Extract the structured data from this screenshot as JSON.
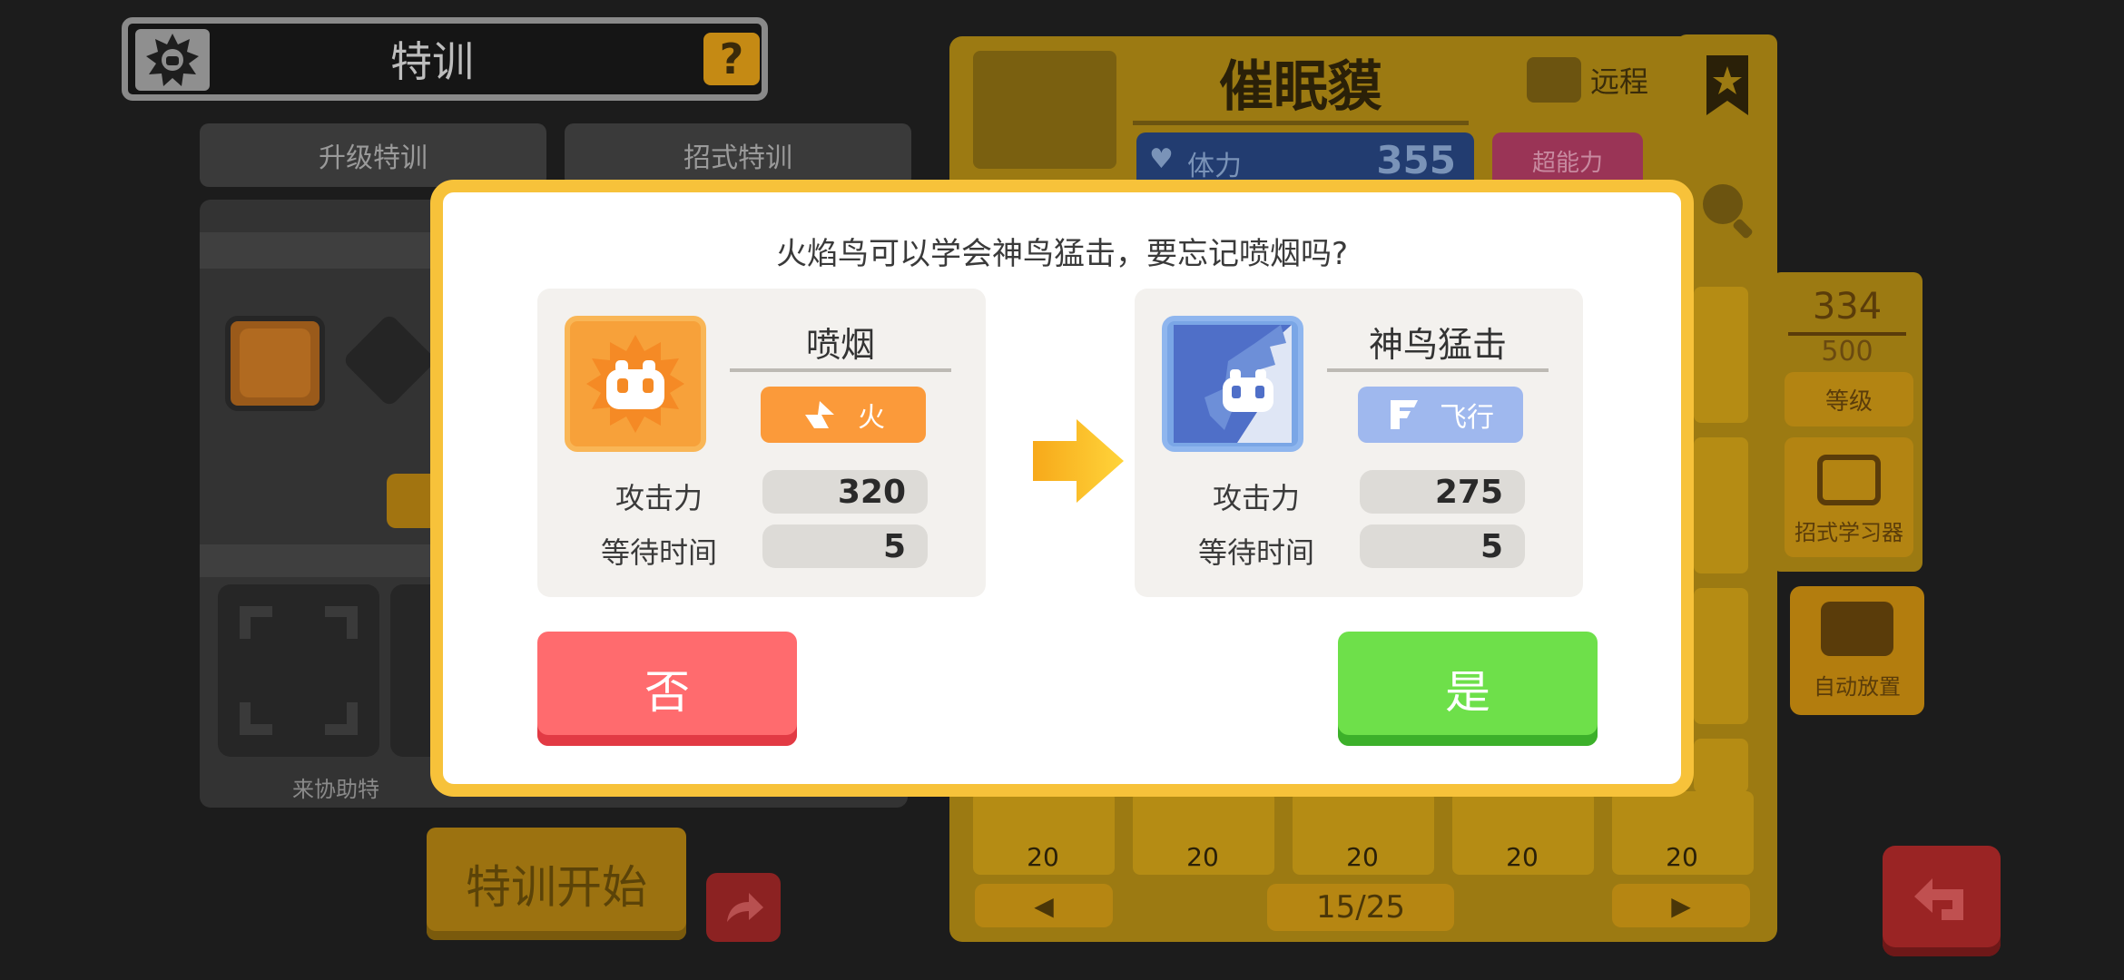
{
  "header": {
    "title": "特训",
    "help_label": "?"
  },
  "tabs": [
    {
      "label": "升级特训"
    },
    {
      "label": "招式特训"
    }
  ],
  "left_panel": {
    "helper_text": "来协助特",
    "start_button": "特训开始"
  },
  "pokemon": {
    "name": "催眠貘",
    "attack_style": "远程",
    "hp_label": "体力",
    "hp_value": "355",
    "type_label": "超能力"
  },
  "level": {
    "current": "334",
    "max": "500",
    "button": "等级"
  },
  "side_buttons": {
    "move_learner": "招式学习器",
    "auto_place": "自动放置"
  },
  "grid": {
    "counts": [
      "20",
      "20",
      "20",
      "20",
      "20"
    ]
  },
  "pager": {
    "prev": "◀",
    "next": "▶",
    "indicator": "15/25"
  },
  "dialog": {
    "question": "火焰鸟可以学会神鸟猛击，要忘记喷烟吗?",
    "old_move": {
      "name": "喷烟",
      "type": "火",
      "attack_label": "攻击力",
      "attack": "320",
      "wait_label": "等待时间",
      "wait": "5",
      "color": "#f7a13a"
    },
    "new_move": {
      "name": "神鸟猛击",
      "type": "飞行",
      "attack_label": "攻击力",
      "attack": "275",
      "wait_label": "等待时间",
      "wait": "5",
      "color": "#7aa6e6"
    },
    "no_label": "否",
    "yes_label": "是"
  },
  "colors": {
    "dialog_border": "#f7c23a",
    "no_button": "#ff6b6e",
    "yes_button": "#6ee04a",
    "fire_pill": "#fb9a3a",
    "flying_pill": "#9fb8ee"
  }
}
